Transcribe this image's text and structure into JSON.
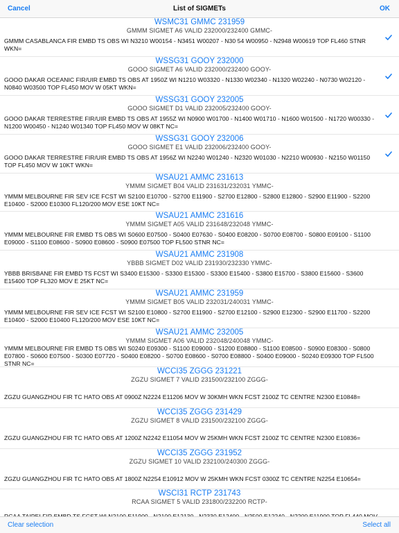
{
  "nav": {
    "cancel": "Cancel",
    "title": "List of SIGMETs",
    "ok": "OK"
  },
  "toolbar": {
    "clear_selection": "Clear selection",
    "select_all": "Select all"
  },
  "items": [
    {
      "header": "WSMC31 GMMC 231959",
      "sub": "GMMM SIGMET A6 VALID 232000/232400 GMMC-",
      "body": "GMMM CASABLANCA FIR EMBD TS OBS WI N3210 W00154 - N3451 W00207 - N30 54 W00950 - N2948 W00619 TOP FL460 STNR WKN=",
      "selected": true
    },
    {
      "header": "WSSG31 GOOY 232000",
      "sub": "GOOO SIGMET A6 VALID 232000/232400 GOOY-",
      "body": "GOOO DAKAR OCEANIC FIR/UIR EMBD TS OBS AT 1950Z WI N1210 W03320 - N1330 W02340 - N1320 W02240 - N0730 W02120 - N0840 W03500 TOP FL450 MOV W 05KT WKN=",
      "selected": true
    },
    {
      "header": "WSSG31 GOOY 232005",
      "sub": "GOOO SIGMET D1 VALID 232005/232400 GOOY-",
      "body": "GOOO DAKAR TERRESTRE FIR/UIR EMBD TS OBS AT 1955Z WI N0900 W01700 - N1400 W01710 - N1600 W01500 - N1720 W00330 - N1200 W00450 - N1240 W01340 TOP FL450 MOV W 08KT NC=",
      "selected": true
    },
    {
      "header": "WSSG31 GOOY 232006",
      "sub": "GOOO SIGMET E1 VALID 232006/232400 GOOY-",
      "body": "GOOO DAKAR TERRESTRE FIR/UIR EMBD TS OBS AT 1956Z WI N2240 W01240 - N2320 W01030 - N2210 W00930 - N2150 W01150 TOP FL450 MOV W 10KT WKN=",
      "selected": true
    },
    {
      "header": "WSAU21 AMMC 231613",
      "sub": "YMMM SIGMET B04 VALID 231631/232031 YMMC-",
      "body": "YMMM MELBOURNE FIR SEV ICE FCST WI S2100 E10700 - S2700 E11900 - S2700 E12800 - S2800 E12800 - S2900 E11900 - S2200 E10400 - S2000 E10300 FL120/200 MOV ESE 10KT NC=",
      "selected": false
    },
    {
      "header": "WSAU21 AMMC 231616",
      "sub": "YMMM SIGMET A05 VALID 231648/232048 YMMC-",
      "body": "YMMM MELBOURNE FIR EMBD TS OBS WI S0600 E07500 - S0400 E07630 - S0400 E08200 - S0700 E08700 - S0800 E09100 - S1100 E09000 - S1100 E08600 - S0900 E08600 - S0900 E07500 TOP FL500 STNR NC=",
      "selected": false
    },
    {
      "header": "WSAU21 AMMC 231908",
      "sub": "YBBB SIGMET D02 VALID 231930/232330 YMMC-",
      "body": "YBBB BRISBANE FIR EMBD TS FCST WI S3400 E15300 - S3300 E15300 - S3300 E15400 - S3800 E15700 - S3800 E15600 - S3600 E15400 TOP FL320 MOV E 25KT NC=",
      "selected": false
    },
    {
      "header": "WSAU21 AMMC 231959",
      "sub": "YMMM SIGMET B05 VALID 232031/240031 YMMC-",
      "body": "YMMM MELBOURNE FIR SEV ICE FCST WI S2100 E10800 - S2700 E11900 - S2700 E12100 - S2900 E12300 - S2900 E11700 - S2200 E10400 - S2000 E10400 FL120/200 MOV ESE 10KT NC=",
      "selected": false
    },
    {
      "header": "WSAU21 AMMC 232005",
      "sub": "YMMM SIGMET A06 VALID 232048/240048 YMMC-",
      "body": "YMMM MELBOURNE FIR EMBD TS OBS WI S0240 E09300 - S1100 E09000 - S1200 E08800 - S1100 E08500 - S0900 E08300 - S0800 E07800 - S0600 E07500 - S0300 E07720 - S0400 E08200 - S0700 E08600 - S0700 E08800 - S0400 E09000 - S0240 E09300 TOP FL500 STNR NC=",
      "selected": false
    },
    {
      "header": "WCCI35 ZGGG 231221",
      "sub": "ZGZU SIGMET 7 VALID 231500/232100 ZGGG-",
      "body": "ZGZU GUANGZHOU FIR TC HATO OBS AT 0900Z N2224 E11206 MOV W 30KMH WKN FCST 2100Z TC CENTRE N2300 E10848=",
      "selected": false
    },
    {
      "header": "WCCI35 ZGGG 231429",
      "sub": "ZGZU SIGMET 8 VALID 231500/232100 ZGGG-",
      "body": "ZGZU GUANGZHOU FIR TC HATO OBS AT 1200Z N2242 E11054 MOV W 25KMH WKN FCST 2100Z TC CENTRE N2300 E10836=",
      "selected": false
    },
    {
      "header": "WCCI35 ZGGG 231952",
      "sub": "ZGZU SIGMET 10 VALID 232100/240300 ZGGG-",
      "body": "ZGZU GUANGZHOU FIR TC HATO OBS AT 1800Z N2254 E10912 MOV W 25KMH WKN FCST 0300Z TC CENTRE N2254 E10654=",
      "selected": false
    },
    {
      "header": "WSCI31 RCTP 231743",
      "sub": "RCAA SIGMET 5 VALID 231800/232200 RCTP-",
      "body": "RCAA TAIPEI FIR EMBD TS FCST WI N2100 E11900 - N2100 E12130 - N2330 E12400 - N2500 E12240 - N2200 E11900 TOP FL440 MOV NW 10KT NC=",
      "selected": false
    }
  ]
}
